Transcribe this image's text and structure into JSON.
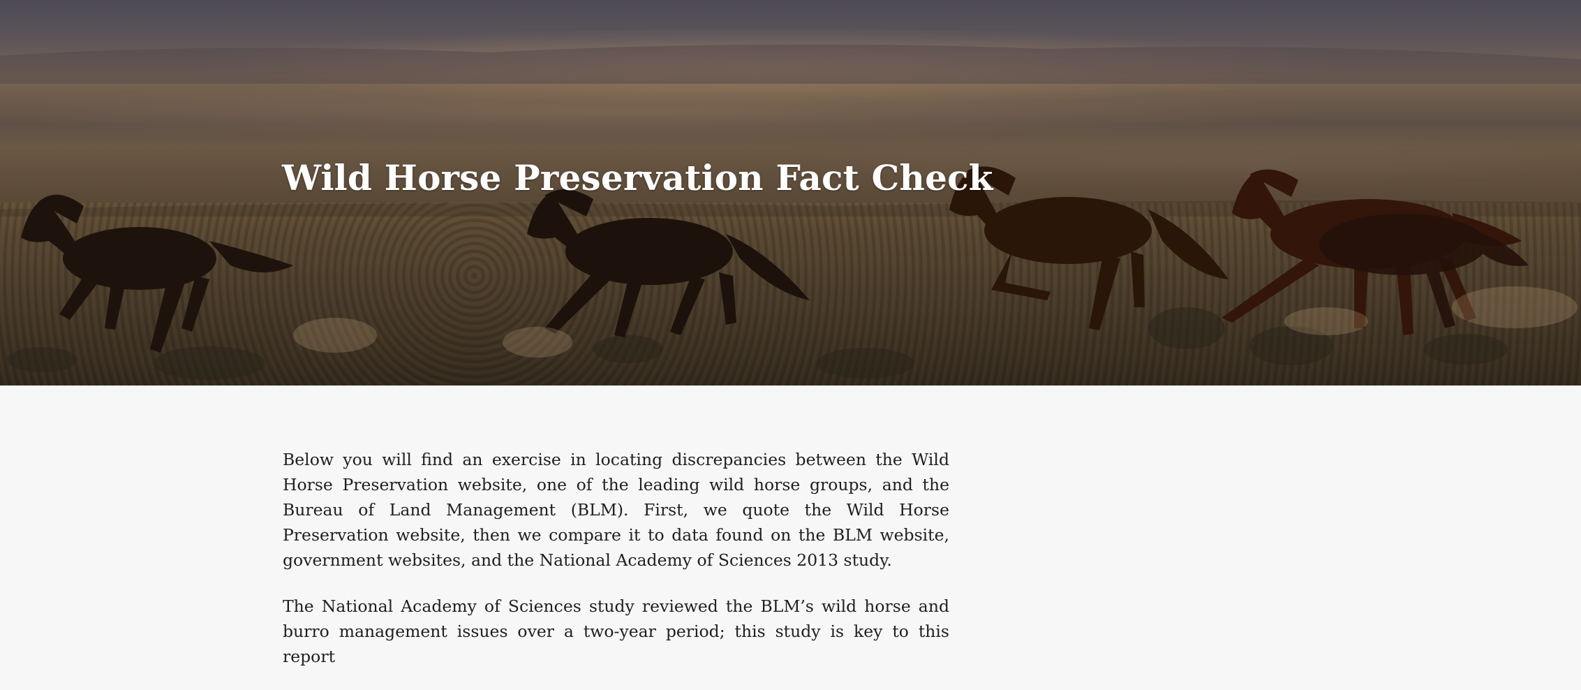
{
  "hero": {
    "title": "Wild Horse Preservation Fact Check",
    "image_description_icon": "running-horses-photo"
  },
  "article": {
    "paragraphs": [
      "Below you will find an exercise in locating discrepancies between the Wild Horse Preservation website, one of the leading wild horse groups, and the Bureau of Land Management (BLM). First, we quote the Wild Horse Preservation website, then we compare it to data found on the BLM website, government websites, and the National Academy of Sciences 2013 study.",
      "The National Academy of Sciences study reviewed the BLM’s wild horse and burro management issues over a two-year period; this study is key to this report"
    ]
  },
  "colors": {
    "page_background": "#f7f7f7",
    "hero_sky": "#4e4a55",
    "hero_ground": "#473b2c",
    "title_text": "#ffffff",
    "body_text": "#1f1f1f"
  }
}
